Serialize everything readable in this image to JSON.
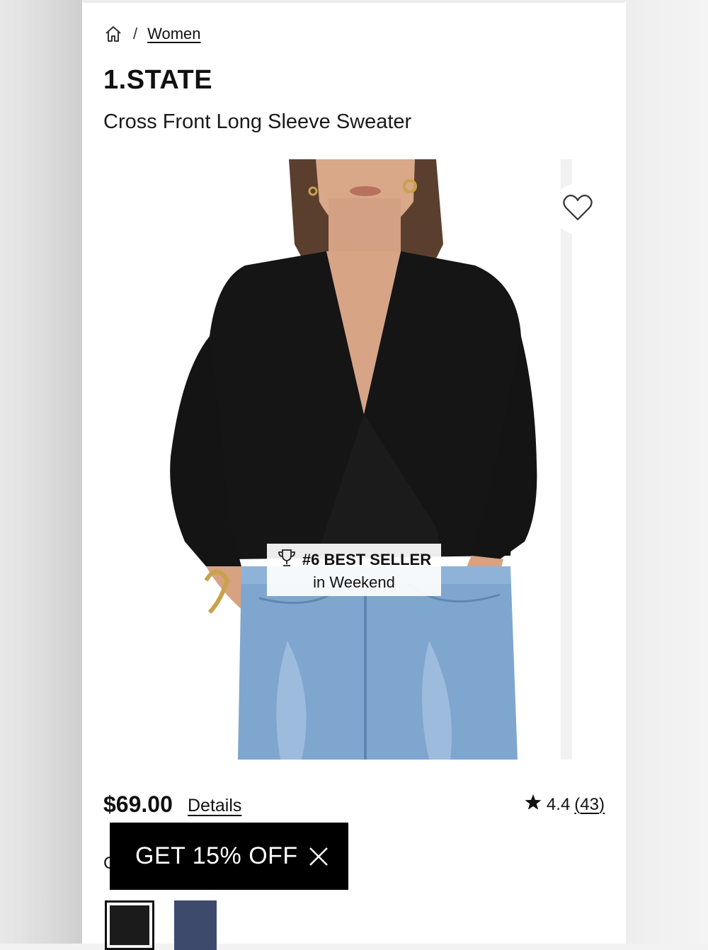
{
  "breadcrumb": {
    "home_icon": "home-icon",
    "separator": "/",
    "current": "Women"
  },
  "product": {
    "brand": "1.STATE",
    "title": "Cross Front Long Sleeve Sweater",
    "price": "$69.00",
    "details_link": "Details",
    "rating": {
      "value": "4.4",
      "count_open": "(",
      "count": "43",
      "count_close": ")",
      "icon": "star-icon"
    }
  },
  "badge": {
    "icon": "trophy-icon",
    "line1": "#6 BEST SELLER",
    "line2": "in Weekend"
  },
  "wishlist": {
    "icon": "heart-icon"
  },
  "promo": {
    "label": "GET 15% OFF",
    "close_icon": "close-icon"
  },
  "color": {
    "label_fragment": "C"
  },
  "swatches": [
    {
      "name": "Black",
      "color": "#1b1b1b",
      "selected": true
    },
    {
      "name": "Navy",
      "color": "#3d4a6c",
      "selected": false
    }
  ],
  "colors": {
    "promo_bg": "#000000",
    "text": "#111111",
    "sweater": "#151515",
    "denim": "#7fa6cf"
  }
}
